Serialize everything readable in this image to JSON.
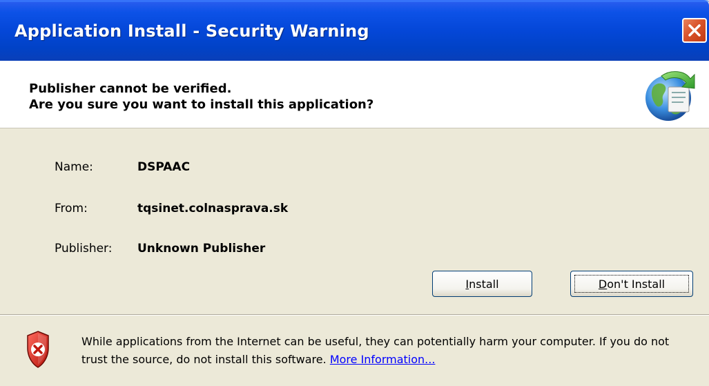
{
  "window": {
    "title": "Application Install - Security Warning",
    "close_icon": "close-icon"
  },
  "header": {
    "line1": "Publisher cannot be verified.",
    "line2": "Are you sure you want to install this application?",
    "icon": "globe-install-icon"
  },
  "details": {
    "name_label": "Name:",
    "name_value": "DSPAAC",
    "from_label": "From:",
    "from_value": "tqsinet.colnasprava.sk",
    "publisher_label": "Publisher:",
    "publisher_value": "Unknown Publisher"
  },
  "buttons": {
    "install_prefix": "",
    "install_accel": "I",
    "install_rest": "nstall",
    "dont_prefix": "",
    "dont_accel": "D",
    "dont_rest": "on't Install"
  },
  "footer": {
    "icon": "shield-warning-icon",
    "warning_text": "While applications from the Internet can be useful, they can potentially harm your computer. If you do not trust the source, do not install this software.",
    "more_info_link": "More Information..."
  },
  "colors": {
    "titlebar": "#0447d8",
    "close_button": "#d9542b",
    "dialog_background": "#ece9d8",
    "link": "#0000ff"
  }
}
